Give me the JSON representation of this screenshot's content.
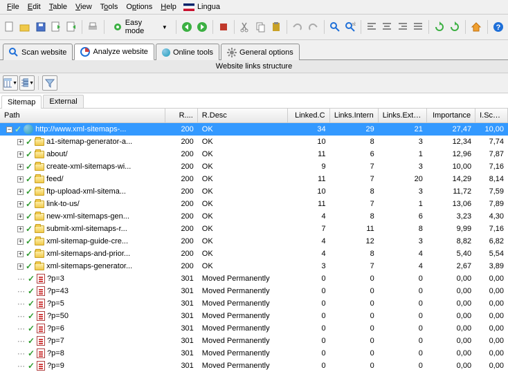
{
  "menu": {
    "file": "File",
    "edit": "Edit",
    "table": "Table",
    "view": "View",
    "tools": "Tools",
    "options": "Options",
    "help": "Help",
    "lingua": "Lingua"
  },
  "toolbar": {
    "easymode": "Easy mode"
  },
  "tabs": {
    "scan": "Scan website",
    "analyze": "Analyze website",
    "online": "Online tools",
    "general": "General options"
  },
  "section_title": "Website links structure",
  "subtabs": {
    "sitemap": "Sitemap",
    "external": "External"
  },
  "columns": {
    "path": "Path",
    "rcode": "R....",
    "rdesc": "R.Desc",
    "linkedc": "Linked.C",
    "intern": "Links.Intern",
    "extern": "Links.Extern",
    "importance": "Importance",
    "iscaled": "I.Scaled"
  },
  "rows": [
    {
      "indent": 0,
      "exp": "-",
      "icon": "globe",
      "path": "http://www.xml-sitemaps-...",
      "rcode": "200",
      "rdesc": "OK",
      "lc": "34",
      "li": "29",
      "le": "21",
      "imp": "27,47",
      "isc": "10,00",
      "sel": true
    },
    {
      "indent": 1,
      "exp": "+",
      "icon": "folder",
      "path": "a1-sitemap-generator-a...",
      "rcode": "200",
      "rdesc": "OK",
      "lc": "10",
      "li": "8",
      "le": "3",
      "imp": "12,34",
      "isc": "7,74"
    },
    {
      "indent": 1,
      "exp": "+",
      "icon": "folder",
      "path": "about/",
      "rcode": "200",
      "rdesc": "OK",
      "lc": "11",
      "li": "6",
      "le": "1",
      "imp": "12,96",
      "isc": "7,87"
    },
    {
      "indent": 1,
      "exp": "+",
      "icon": "folder",
      "path": "create-xml-sitemaps-wi...",
      "rcode": "200",
      "rdesc": "OK",
      "lc": "9",
      "li": "7",
      "le": "3",
      "imp": "10,00",
      "isc": "7,16"
    },
    {
      "indent": 1,
      "exp": "+",
      "icon": "folder",
      "path": "feed/",
      "rcode": "200",
      "rdesc": "OK",
      "lc": "11",
      "li": "7",
      "le": "20",
      "imp": "14,29",
      "isc": "8,14"
    },
    {
      "indent": 1,
      "exp": "+",
      "icon": "folder",
      "path": "ftp-upload-xml-sitema...",
      "rcode": "200",
      "rdesc": "OK",
      "lc": "10",
      "li": "8",
      "le": "3",
      "imp": "11,72",
      "isc": "7,59"
    },
    {
      "indent": 1,
      "exp": "+",
      "icon": "folder",
      "path": "link-to-us/",
      "rcode": "200",
      "rdesc": "OK",
      "lc": "11",
      "li": "7",
      "le": "1",
      "imp": "13,06",
      "isc": "7,89"
    },
    {
      "indent": 1,
      "exp": "+",
      "icon": "folder",
      "path": "new-xml-sitemaps-gen...",
      "rcode": "200",
      "rdesc": "OK",
      "lc": "4",
      "li": "8",
      "le": "6",
      "imp": "3,23",
      "isc": "4,30"
    },
    {
      "indent": 1,
      "exp": "+",
      "icon": "folder",
      "path": "submit-xml-sitemaps-r...",
      "rcode": "200",
      "rdesc": "OK",
      "lc": "7",
      "li": "11",
      "le": "8",
      "imp": "9,99",
      "isc": "7,16"
    },
    {
      "indent": 1,
      "exp": "+",
      "icon": "folder",
      "path": "xml-sitemap-guide-cre...",
      "rcode": "200",
      "rdesc": "OK",
      "lc": "4",
      "li": "12",
      "le": "3",
      "imp": "8,82",
      "isc": "6,82"
    },
    {
      "indent": 1,
      "exp": "+",
      "icon": "folder",
      "path": "xml-sitemaps-and-prior...",
      "rcode": "200",
      "rdesc": "OK",
      "lc": "4",
      "li": "8",
      "le": "4",
      "imp": "5,40",
      "isc": "5,54"
    },
    {
      "indent": 1,
      "exp": "+",
      "icon": "folder",
      "path": "xml-sitemaps-generator...",
      "rcode": "200",
      "rdesc": "OK",
      "lc": "3",
      "li": "7",
      "le": "4",
      "imp": "2,67",
      "isc": "3,89"
    },
    {
      "indent": 1,
      "icon": "redpage",
      "path": "?p=3",
      "rcode": "301",
      "rdesc": "Moved Permanently",
      "lc": "0",
      "li": "0",
      "le": "0",
      "imp": "0,00",
      "isc": "0,00"
    },
    {
      "indent": 1,
      "icon": "redpage",
      "path": "?p=43",
      "rcode": "301",
      "rdesc": "Moved Permanently",
      "lc": "0",
      "li": "0",
      "le": "0",
      "imp": "0,00",
      "isc": "0,00"
    },
    {
      "indent": 1,
      "icon": "redpage",
      "path": "?p=5",
      "rcode": "301",
      "rdesc": "Moved Permanently",
      "lc": "0",
      "li": "0",
      "le": "0",
      "imp": "0,00",
      "isc": "0,00"
    },
    {
      "indent": 1,
      "icon": "redpage",
      "path": "?p=50",
      "rcode": "301",
      "rdesc": "Moved Permanently",
      "lc": "0",
      "li": "0",
      "le": "0",
      "imp": "0,00",
      "isc": "0,00"
    },
    {
      "indent": 1,
      "icon": "redpage",
      "path": "?p=6",
      "rcode": "301",
      "rdesc": "Moved Permanently",
      "lc": "0",
      "li": "0",
      "le": "0",
      "imp": "0,00",
      "isc": "0,00"
    },
    {
      "indent": 1,
      "icon": "redpage",
      "path": "?p=7",
      "rcode": "301",
      "rdesc": "Moved Permanently",
      "lc": "0",
      "li": "0",
      "le": "0",
      "imp": "0,00",
      "isc": "0,00"
    },
    {
      "indent": 1,
      "icon": "redpage",
      "path": "?p=8",
      "rcode": "301",
      "rdesc": "Moved Permanently",
      "lc": "0",
      "li": "0",
      "le": "0",
      "imp": "0,00",
      "isc": "0,00"
    },
    {
      "indent": 1,
      "icon": "redpage",
      "path": "?p=9",
      "rcode": "301",
      "rdesc": "Moved Permanently",
      "lc": "0",
      "li": "0",
      "le": "0",
      "imp": "0,00",
      "isc": "0,00"
    }
  ]
}
